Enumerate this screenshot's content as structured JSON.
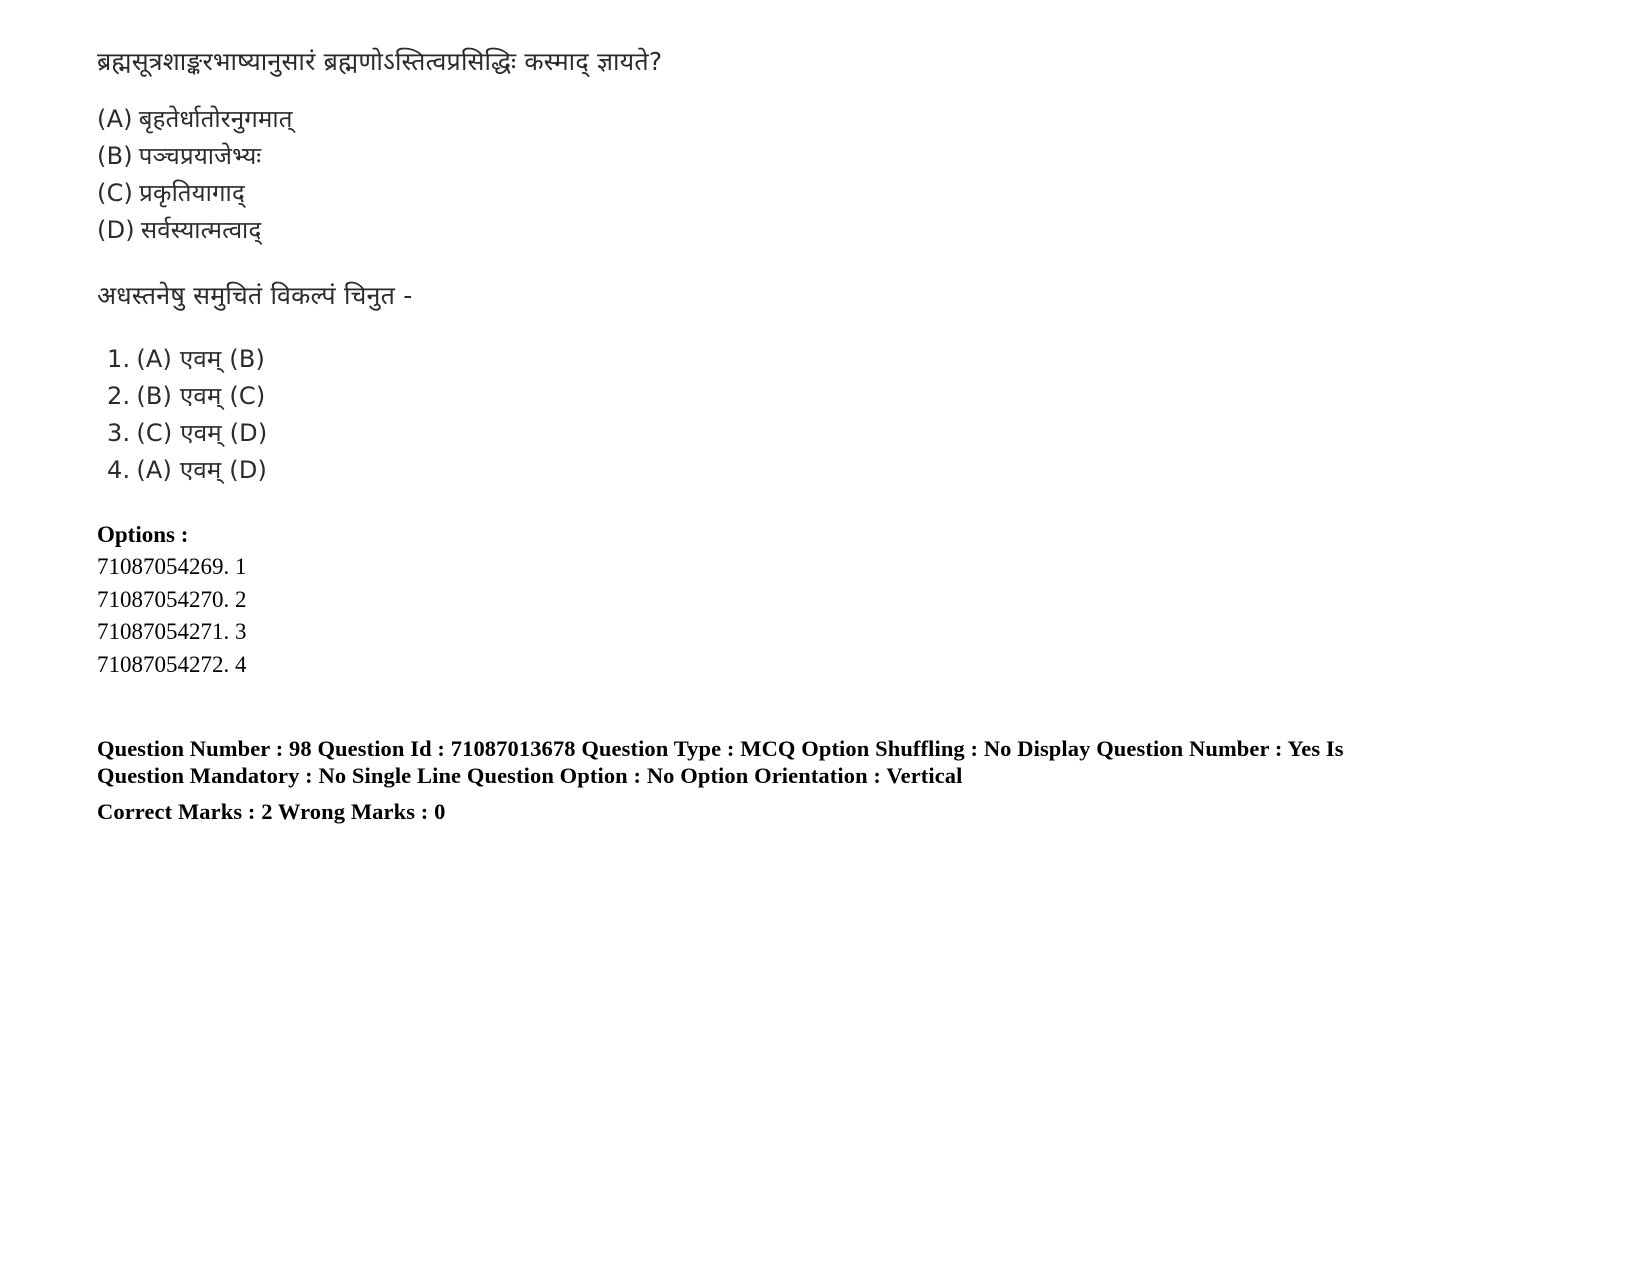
{
  "question": {
    "stem": "ब्रह्मसूत्रशाङ्करभाष्यानुसारं ब्रह्मणोऽस्तित्वप्रसिद्धिः कस्माद् ज्ञायते?",
    "choices": [
      {
        "tag": "(A)",
        "text": "बृहतेर्धातोरनुगमात्"
      },
      {
        "tag": "(B)",
        "text": "पञ्चप्रयाजेभ्यः"
      },
      {
        "tag": "(C)",
        "text": "प्रकृतियागाद्"
      },
      {
        "tag": "(D)",
        "text": "सर्वस्यात्मत्वाद्"
      }
    ],
    "instruction": "अधस्तनेषु समुचितं विकल्पं चिनुत -",
    "answers": [
      {
        "number": "1.",
        "text": "(A) एवम् (B)"
      },
      {
        "number": "2.",
        "text": "(B) एवम् (C)"
      },
      {
        "number": "3.",
        "text": "(C) एवम् (D)"
      },
      {
        "number": "4.",
        "text": "(A) एवम् (D)"
      }
    ]
  },
  "options_section": {
    "heading": "Options :",
    "items": [
      {
        "id": "71087054269.",
        "value": "1"
      },
      {
        "id": "71087054270.",
        "value": "2"
      },
      {
        "id": "71087054271.",
        "value": "3"
      },
      {
        "id": "71087054272.",
        "value": "4"
      }
    ]
  },
  "metadata": {
    "line1": "Question Number : 98 Question Id : 71087013678 Question Type : MCQ Option Shuffling : No Display Question Number : Yes Is Question Mandatory : No Single Line Question Option : No Option Orientation : Vertical",
    "line2": "Correct Marks : 2 Wrong Marks : 0"
  }
}
